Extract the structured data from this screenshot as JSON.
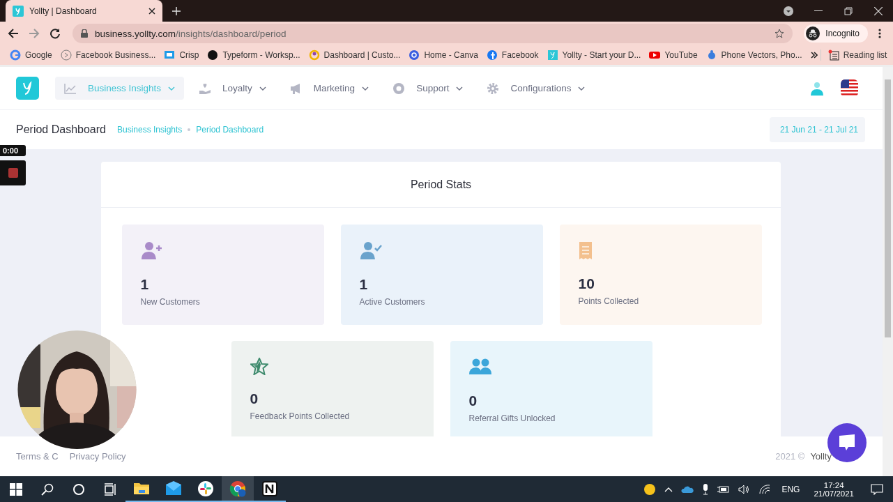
{
  "browser": {
    "tab": {
      "title": "Yollty | Dashboard",
      "selected": true
    },
    "url": {
      "host": "business.yollty.com",
      "path": "/insights/dashboard/period"
    },
    "profile": "Incognito",
    "bookmarks": [
      {
        "label": "Google"
      },
      {
        "label": "Facebook Business..."
      },
      {
        "label": "Crisp"
      },
      {
        "label": "Typeform - Worksp..."
      },
      {
        "label": "Dashboard | Custo..."
      },
      {
        "label": "Home - Canva"
      },
      {
        "label": "Facebook"
      },
      {
        "label": "Yollty - Start your D..."
      },
      {
        "label": "YouTube"
      },
      {
        "label": "Phone Vectors, Pho..."
      }
    ],
    "reading_list": "Reading list"
  },
  "nav": [
    {
      "label": "Business Insights",
      "selected": true
    },
    {
      "label": "Loyalty",
      "selected": false
    },
    {
      "label": "Marketing",
      "selected": false
    },
    {
      "label": "Support",
      "selected": false
    },
    {
      "label": "Configurations",
      "selected": false
    }
  ],
  "page_title": "Period Dashboard",
  "breadcrumb": [
    "Business Insights",
    "Period Dashboard"
  ],
  "date_range": "21 Jun 21 - 21 Jul 21",
  "recording": {
    "time": "0:00"
  },
  "card": {
    "title": "Period Stats",
    "stats": [
      {
        "value": "1",
        "label": "New Customers",
        "color": "#a98bc9"
      },
      {
        "value": "1",
        "label": "Active Customers",
        "color": "#6aa3cc"
      },
      {
        "value": "10",
        "label": "Points Collected",
        "color": "#f3c08e"
      },
      {
        "value": "0",
        "label": "Feedback Points Collected",
        "color": "#3d8a6c"
      },
      {
        "value": "0",
        "label": "Referral Gifts Unlocked",
        "color": "#3ba6da"
      }
    ]
  },
  "footer": {
    "links": [
      "Terms & C",
      "Privacy Policy"
    ],
    "copyright": "2021 ©",
    "brand": "Yollty"
  },
  "taskbar": {
    "apps": [
      {
        "selected": false
      },
      {
        "selected": false
      },
      {
        "selected": false
      },
      {
        "selected": true
      },
      {
        "selected": false
      }
    ],
    "language": "ENG",
    "time": "17:24",
    "date": "21/07/2021"
  }
}
